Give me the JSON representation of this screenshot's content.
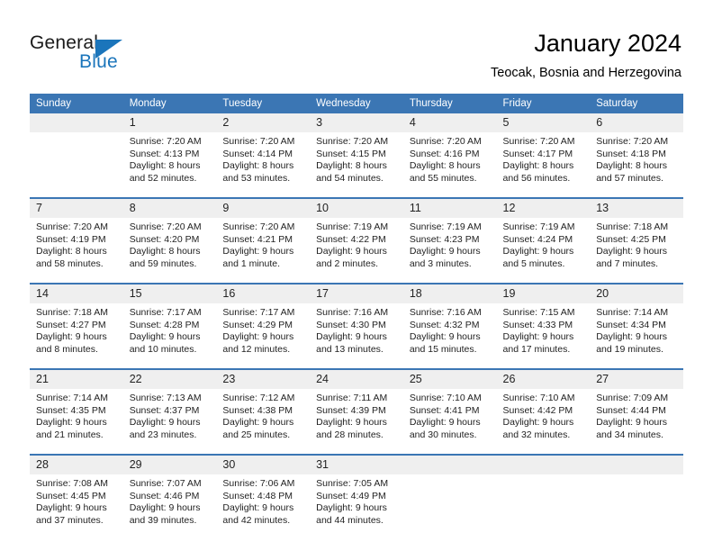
{
  "brand": {
    "name_part1": "General",
    "name_part2": "Blue",
    "accent_color": "#1b75bb"
  },
  "header": {
    "title": "January 2024",
    "location": "Teocak, Bosnia and Herzegovina",
    "header_bg_color": "#3b76b4",
    "daynum_bg_color": "#efefef"
  },
  "weekday_headers": [
    "Sunday",
    "Monday",
    "Tuesday",
    "Wednesday",
    "Thursday",
    "Friday",
    "Saturday"
  ],
  "weeks": [
    [
      {
        "day": "",
        "sunrise": "",
        "sunset": "",
        "daylight1": "",
        "daylight2": ""
      },
      {
        "day": "1",
        "sunrise": "Sunrise: 7:20 AM",
        "sunset": "Sunset: 4:13 PM",
        "daylight1": "Daylight: 8 hours",
        "daylight2": "and 52 minutes."
      },
      {
        "day": "2",
        "sunrise": "Sunrise: 7:20 AM",
        "sunset": "Sunset: 4:14 PM",
        "daylight1": "Daylight: 8 hours",
        "daylight2": "and 53 minutes."
      },
      {
        "day": "3",
        "sunrise": "Sunrise: 7:20 AM",
        "sunset": "Sunset: 4:15 PM",
        "daylight1": "Daylight: 8 hours",
        "daylight2": "and 54 minutes."
      },
      {
        "day": "4",
        "sunrise": "Sunrise: 7:20 AM",
        "sunset": "Sunset: 4:16 PM",
        "daylight1": "Daylight: 8 hours",
        "daylight2": "and 55 minutes."
      },
      {
        "day": "5",
        "sunrise": "Sunrise: 7:20 AM",
        "sunset": "Sunset: 4:17 PM",
        "daylight1": "Daylight: 8 hours",
        "daylight2": "and 56 minutes."
      },
      {
        "day": "6",
        "sunrise": "Sunrise: 7:20 AM",
        "sunset": "Sunset: 4:18 PM",
        "daylight1": "Daylight: 8 hours",
        "daylight2": "and 57 minutes."
      }
    ],
    [
      {
        "day": "7",
        "sunrise": "Sunrise: 7:20 AM",
        "sunset": "Sunset: 4:19 PM",
        "daylight1": "Daylight: 8 hours",
        "daylight2": "and 58 minutes."
      },
      {
        "day": "8",
        "sunrise": "Sunrise: 7:20 AM",
        "sunset": "Sunset: 4:20 PM",
        "daylight1": "Daylight: 8 hours",
        "daylight2": "and 59 minutes."
      },
      {
        "day": "9",
        "sunrise": "Sunrise: 7:20 AM",
        "sunset": "Sunset: 4:21 PM",
        "daylight1": "Daylight: 9 hours",
        "daylight2": "and 1 minute."
      },
      {
        "day": "10",
        "sunrise": "Sunrise: 7:19 AM",
        "sunset": "Sunset: 4:22 PM",
        "daylight1": "Daylight: 9 hours",
        "daylight2": "and 2 minutes."
      },
      {
        "day": "11",
        "sunrise": "Sunrise: 7:19 AM",
        "sunset": "Sunset: 4:23 PM",
        "daylight1": "Daylight: 9 hours",
        "daylight2": "and 3 minutes."
      },
      {
        "day": "12",
        "sunrise": "Sunrise: 7:19 AM",
        "sunset": "Sunset: 4:24 PM",
        "daylight1": "Daylight: 9 hours",
        "daylight2": "and 5 minutes."
      },
      {
        "day": "13",
        "sunrise": "Sunrise: 7:18 AM",
        "sunset": "Sunset: 4:25 PM",
        "daylight1": "Daylight: 9 hours",
        "daylight2": "and 7 minutes."
      }
    ],
    [
      {
        "day": "14",
        "sunrise": "Sunrise: 7:18 AM",
        "sunset": "Sunset: 4:27 PM",
        "daylight1": "Daylight: 9 hours",
        "daylight2": "and 8 minutes."
      },
      {
        "day": "15",
        "sunrise": "Sunrise: 7:17 AM",
        "sunset": "Sunset: 4:28 PM",
        "daylight1": "Daylight: 9 hours",
        "daylight2": "and 10 minutes."
      },
      {
        "day": "16",
        "sunrise": "Sunrise: 7:17 AM",
        "sunset": "Sunset: 4:29 PM",
        "daylight1": "Daylight: 9 hours",
        "daylight2": "and 12 minutes."
      },
      {
        "day": "17",
        "sunrise": "Sunrise: 7:16 AM",
        "sunset": "Sunset: 4:30 PM",
        "daylight1": "Daylight: 9 hours",
        "daylight2": "and 13 minutes."
      },
      {
        "day": "18",
        "sunrise": "Sunrise: 7:16 AM",
        "sunset": "Sunset: 4:32 PM",
        "daylight1": "Daylight: 9 hours",
        "daylight2": "and 15 minutes."
      },
      {
        "day": "19",
        "sunrise": "Sunrise: 7:15 AM",
        "sunset": "Sunset: 4:33 PM",
        "daylight1": "Daylight: 9 hours",
        "daylight2": "and 17 minutes."
      },
      {
        "day": "20",
        "sunrise": "Sunrise: 7:14 AM",
        "sunset": "Sunset: 4:34 PM",
        "daylight1": "Daylight: 9 hours",
        "daylight2": "and 19 minutes."
      }
    ],
    [
      {
        "day": "21",
        "sunrise": "Sunrise: 7:14 AM",
        "sunset": "Sunset: 4:35 PM",
        "daylight1": "Daylight: 9 hours",
        "daylight2": "and 21 minutes."
      },
      {
        "day": "22",
        "sunrise": "Sunrise: 7:13 AM",
        "sunset": "Sunset: 4:37 PM",
        "daylight1": "Daylight: 9 hours",
        "daylight2": "and 23 minutes."
      },
      {
        "day": "23",
        "sunrise": "Sunrise: 7:12 AM",
        "sunset": "Sunset: 4:38 PM",
        "daylight1": "Daylight: 9 hours",
        "daylight2": "and 25 minutes."
      },
      {
        "day": "24",
        "sunrise": "Sunrise: 7:11 AM",
        "sunset": "Sunset: 4:39 PM",
        "daylight1": "Daylight: 9 hours",
        "daylight2": "and 28 minutes."
      },
      {
        "day": "25",
        "sunrise": "Sunrise: 7:10 AM",
        "sunset": "Sunset: 4:41 PM",
        "daylight1": "Daylight: 9 hours",
        "daylight2": "and 30 minutes."
      },
      {
        "day": "26",
        "sunrise": "Sunrise: 7:10 AM",
        "sunset": "Sunset: 4:42 PM",
        "daylight1": "Daylight: 9 hours",
        "daylight2": "and 32 minutes."
      },
      {
        "day": "27",
        "sunrise": "Sunrise: 7:09 AM",
        "sunset": "Sunset: 4:44 PM",
        "daylight1": "Daylight: 9 hours",
        "daylight2": "and 34 minutes."
      }
    ],
    [
      {
        "day": "28",
        "sunrise": "Sunrise: 7:08 AM",
        "sunset": "Sunset: 4:45 PM",
        "daylight1": "Daylight: 9 hours",
        "daylight2": "and 37 minutes."
      },
      {
        "day": "29",
        "sunrise": "Sunrise: 7:07 AM",
        "sunset": "Sunset: 4:46 PM",
        "daylight1": "Daylight: 9 hours",
        "daylight2": "and 39 minutes."
      },
      {
        "day": "30",
        "sunrise": "Sunrise: 7:06 AM",
        "sunset": "Sunset: 4:48 PM",
        "daylight1": "Daylight: 9 hours",
        "daylight2": "and 42 minutes."
      },
      {
        "day": "31",
        "sunrise": "Sunrise: 7:05 AM",
        "sunset": "Sunset: 4:49 PM",
        "daylight1": "Daylight: 9 hours",
        "daylight2": "and 44 minutes."
      },
      {
        "day": "",
        "sunrise": "",
        "sunset": "",
        "daylight1": "",
        "daylight2": ""
      },
      {
        "day": "",
        "sunrise": "",
        "sunset": "",
        "daylight1": "",
        "daylight2": ""
      },
      {
        "day": "",
        "sunrise": "",
        "sunset": "",
        "daylight1": "",
        "daylight2": ""
      }
    ]
  ]
}
